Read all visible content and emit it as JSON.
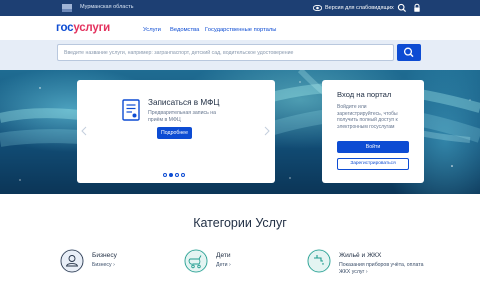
{
  "topbar": {
    "region": "Мурманская область",
    "vision_label": "Версия для слабовидящих"
  },
  "header": {
    "logo_part1": "гос",
    "logo_part2": "услуги",
    "nav": [
      "Услуги",
      "Ведомства",
      "Государственные порталы"
    ]
  },
  "search": {
    "placeholder": "Введите название услуги, например: загранпаспорт, детский сад, водительское удостоверение"
  },
  "carousel": {
    "title": "Записаться в МФЦ",
    "description": "Предварительная запись на приём в МФЦ",
    "button_label": "Подробнее",
    "slides": 4,
    "active_slide": 2
  },
  "login": {
    "title": "Вход на портал",
    "text": "Войдите или зарегистрируйтесь, чтобы получить полный доступ к электронным госуслугам",
    "login_label": "Войти",
    "register_label": "Зарегистрироваться"
  },
  "categories": {
    "title": "Категории Услуг",
    "items": [
      {
        "name": "Бизнесу",
        "link": "Бизнесу",
        "icon": "business-icon"
      },
      {
        "name": "Дети",
        "link": "Дети",
        "icon": "children-icon"
      },
      {
        "name": "Жильё и ЖКХ",
        "link": "Показания приборов учёта, оплата ЖКХ услуг",
        "icon": "housing-icon"
      }
    ]
  },
  "colors": {
    "primary": "#0d4cd3",
    "logo_accent": "#e3325e",
    "topbar": "#1d3f73",
    "text_dark": "#233146"
  }
}
